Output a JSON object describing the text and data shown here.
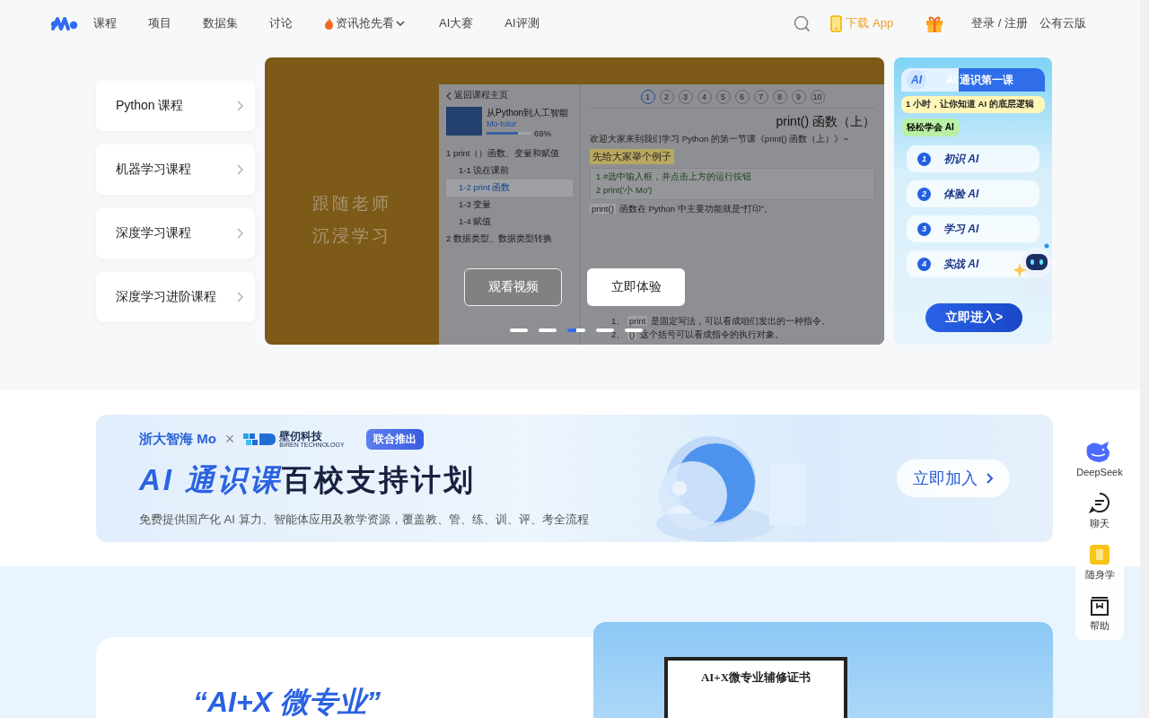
{
  "header": {
    "nav": [
      {
        "label": "课程",
        "kind": "link"
      },
      {
        "label": "项目",
        "kind": "link"
      },
      {
        "label": "数据集",
        "kind": "link"
      },
      {
        "label": "讨论",
        "kind": "link"
      },
      {
        "label": "资讯抢先看",
        "kind": "hot"
      },
      {
        "label": "AI大赛",
        "kind": "link"
      },
      {
        "label": "AI评测",
        "kind": "link"
      }
    ],
    "download": "下载 App",
    "login": "登录 / 注册",
    "cloud": "公有云版"
  },
  "course_menu": [
    "Python 课程",
    "机器学习课程",
    "深度学习课程",
    "深度学习进阶课程"
  ],
  "carousel": {
    "caption": [
      "跟随老师",
      "沉浸学习"
    ],
    "app": {
      "back": "返回课程主页",
      "course_title": "从Python到人工智能",
      "tag": "Mo-tutor",
      "progress_text": "69%",
      "level": 0.69,
      "outline": [
        {
          "label": "1 print（）函数、变量和赋值",
          "selected": false,
          "children": [
            {
              "label": "1-1 说在课前",
              "selected": false
            },
            {
              "label": "1-2 print 函数",
              "selected": true
            },
            {
              "label": "1-3 变量",
              "selected": false
            },
            {
              "label": "1-4 赋值",
              "selected": false
            }
          ]
        },
        {
          "label": "2 数据类型、数据类型转换",
          "selected": false
        }
      ],
      "steps": [
        {
          "label": "1",
          "selected": true
        },
        {
          "label": "2",
          "selected": false
        },
        {
          "label": "3",
          "selected": false
        },
        {
          "label": "4",
          "selected": false
        },
        {
          "label": "5",
          "selected": false
        },
        {
          "label": "6",
          "selected": false
        },
        {
          "label": "7",
          "selected": false
        },
        {
          "label": "8",
          "selected": false
        },
        {
          "label": "9",
          "selected": false
        },
        {
          "label": "10",
          "selected": false
        }
      ],
      "lesson_title": "print() 函数（上）",
      "intro": "欢迎大家来到我们学习 Python 的第一节课《print() 函数（上）》~",
      "example": "先给大家举个例子",
      "code": [
        {
          "num": "1",
          "text": "#选中输入框，并点击上方的运行按钮"
        },
        {
          "num": "2",
          "text": "print('小 Mo')"
        }
      ],
      "body": [
        {
          "kind": "code",
          "text": "print()"
        },
        {
          "kind": "text",
          "text": "函数在 Python 中主要功能就是“打印”。"
        }
      ],
      "list": [
        {
          "num": "1、",
          "code": "print",
          "text": "是固定写法，可以看成咱们发出的一种指令。"
        },
        {
          "num": "2、",
          "code": "()",
          "text": "这个括号可以看成指令的执行对象。"
        }
      ]
    },
    "buttons": [
      {
        "label": "观看视频",
        "kind": "outline"
      },
      {
        "label": "立即体验",
        "kind": "solid"
      }
    ],
    "slides": [
      {
        "selected": false
      },
      {
        "selected": false
      },
      {
        "selected": true
      },
      {
        "selected": false
      },
      {
        "selected": false
      }
    ]
  },
  "promo": {
    "badge": "AI",
    "title": "AI 通识第一课",
    "tagline": "1 小时，让你知道 AI 的底层逻辑",
    "tag": "轻松学会 AI",
    "steps": [
      {
        "num": "1",
        "label": "初识 AI"
      },
      {
        "num": "2",
        "label": "体验 AI"
      },
      {
        "num": "3",
        "label": "学习 AI"
      },
      {
        "num": "4",
        "label": "实战 AI"
      }
    ],
    "button": "立即进入>"
  },
  "banner": {
    "brand": "浙大智海 Mo",
    "times": "×",
    "partner": "壁仞科技",
    "partner_en": "BIREN TECHNOLOGY",
    "badge": "联合推出",
    "headline_highlight": "AI 通识课",
    "headline_rest": "百校支持计划",
    "subtitle": "免费提供国产化 AI 算力、智能体应用及教学资源，覆盖教、管、练、训、评、考全流程",
    "button": "立即加入"
  },
  "dock": [
    {
      "label": "DeepSeek",
      "kind": "deepseek"
    },
    {
      "label": "聊天",
      "kind": "chat"
    },
    {
      "label": "随身学",
      "kind": "mobile"
    },
    {
      "label": "帮助",
      "kind": "help"
    }
  ],
  "bottom": {
    "heading": "“AI+X 微专业”",
    "certificate": "AI+X微专业辅修证书"
  }
}
